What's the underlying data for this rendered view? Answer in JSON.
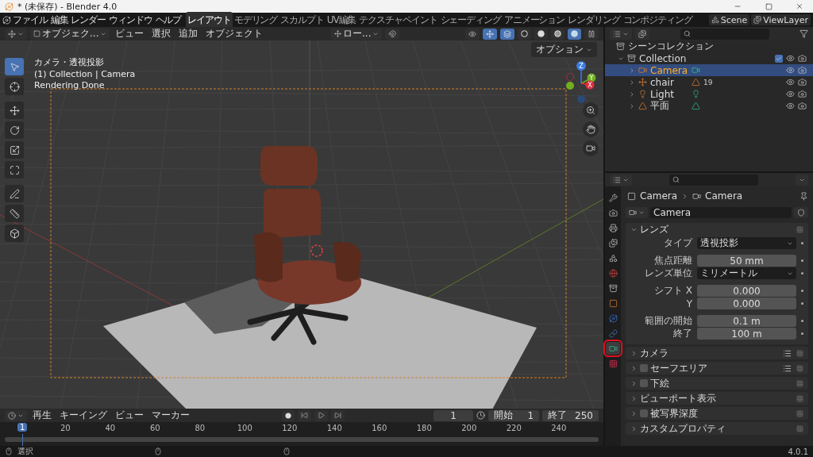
{
  "window": {
    "title": "* (未保存) - Blender 4.0"
  },
  "menu": [
    "ファイル",
    "編集",
    "レンダー",
    "ウィンドウ",
    "ヘルプ"
  ],
  "workspaces": [
    {
      "label": "レイアウト",
      "selected": true
    },
    {
      "label": "モデリング",
      "selected": false
    },
    {
      "label": "スカルプト",
      "selected": false
    },
    {
      "label": "UV編集",
      "selected": false
    },
    {
      "label": "テクスチャペイント",
      "selected": false
    },
    {
      "label": "シェーディング",
      "selected": false
    },
    {
      "label": "アニメーション",
      "selected": false
    },
    {
      "label": "レンダリング",
      "selected": false
    },
    {
      "label": "コンポジティング",
      "selected": false
    }
  ],
  "scene": "Scene",
  "view_layer": "ViewLayer",
  "viewport": {
    "mode": "オブジェク...",
    "menus": [
      "ビュー",
      "選択",
      "追加",
      "オブジェクト"
    ],
    "orientation": "ロー...",
    "options": "オプション",
    "shading": [
      {
        "kind": "wireframe",
        "selected": false
      },
      {
        "kind": "solid",
        "selected": false
      },
      {
        "kind": "material",
        "selected": false
      },
      {
        "kind": "rendered",
        "selected": true
      }
    ],
    "info": [
      "カメラ・透視投影",
      "(1) Collection | Camera",
      "Rendering Done"
    ],
    "tools": [
      {
        "kind": "select",
        "selected": true
      },
      {
        "kind": "cursor",
        "selected": false
      },
      {
        "kind": "move",
        "selected": false
      },
      {
        "kind": "rotate",
        "selected": false
      },
      {
        "kind": "scale",
        "selected": false
      },
      {
        "kind": "transform",
        "selected": false
      },
      {
        "kind": "annotate",
        "selected": false
      },
      {
        "kind": "measure",
        "selected": false
      },
      {
        "kind": "add-cube",
        "selected": false
      }
    ],
    "gizmo": {
      "z": "Z",
      "y": "Y",
      "x": "X"
    }
  },
  "outliner": {
    "root": "シーンコレクション",
    "collection": {
      "name": "Collection",
      "checked": true,
      "children": [
        {
          "name": "Camera",
          "kind": "camera",
          "selected": true
        },
        {
          "name": "chair",
          "kind": "empty",
          "selected": false,
          "data_count": "19"
        },
        {
          "name": "Light",
          "kind": "light",
          "selected": false
        },
        {
          "name": "平面",
          "kind": "mesh",
          "selected": false
        }
      ]
    }
  },
  "properties": {
    "tabs": [
      {
        "kind": "tool",
        "selected": false
      },
      {
        "kind": "render",
        "selected": false
      },
      {
        "kind": "output",
        "selected": false
      },
      {
        "kind": "view-layer",
        "selected": false
      },
      {
        "kind": "scene",
        "selected": false
      },
      {
        "kind": "world",
        "selected": false
      },
      {
        "kind": "collection",
        "selected": false
      },
      {
        "kind": "object",
        "selected": false
      },
      {
        "kind": "physics",
        "selected": false
      },
      {
        "kind": "constraints",
        "selected": false
      },
      {
        "kind": "camera-data",
        "selected": true
      },
      {
        "kind": "texture",
        "selected": false
      }
    ],
    "breadcrumb": [
      "Camera",
      "Camera"
    ],
    "datablock": "Camera",
    "lens": {
      "title": "レンズ",
      "expanded": true,
      "groups": [
        [
          {
            "label": "タイプ",
            "value": "透視投影",
            "kind": "dropdown"
          }
        ],
        [
          {
            "label": "焦点距離",
            "value": "50 mm",
            "kind": "number"
          },
          {
            "label": "レンズ単位",
            "value": "ミリメートル",
            "kind": "dropdown"
          }
        ],
        [
          {
            "label": "シフト X",
            "value": "0.000",
            "kind": "number"
          },
          {
            "label": "Y",
            "value": "0.000",
            "kind": "number"
          }
        ],
        [
          {
            "label": "範囲の開始",
            "value": "0.1 m",
            "kind": "number"
          },
          {
            "label": "終了",
            "value": "100 m",
            "kind": "number"
          }
        ]
      ]
    },
    "panels": [
      {
        "title": "カメラ",
        "expanded": false,
        "presets": true
      },
      {
        "title": "セーフエリア",
        "expanded": false,
        "checked": false,
        "presets": true
      },
      {
        "title": "下絵",
        "expanded": false,
        "checked": false
      },
      {
        "title": "ビューポート表示",
        "expanded": false
      },
      {
        "title": "被写界深度",
        "expanded": false,
        "checked": false
      },
      {
        "title": "カスタムプロパティ",
        "expanded": false
      }
    ]
  },
  "timeline": {
    "menus": [
      "再生",
      "キーイング",
      "ビュー",
      "マーカー"
    ],
    "current_frame": "1",
    "start_label": "開始",
    "start": "1",
    "end_label": "終了",
    "end": "250",
    "ticks": [
      "20",
      "40",
      "60",
      "80",
      "100",
      "120",
      "140",
      "160",
      "180",
      "200",
      "220",
      "240"
    ],
    "cursor": "1"
  },
  "status_bar": {
    "action": "選択",
    "version": "4.0.1"
  }
}
